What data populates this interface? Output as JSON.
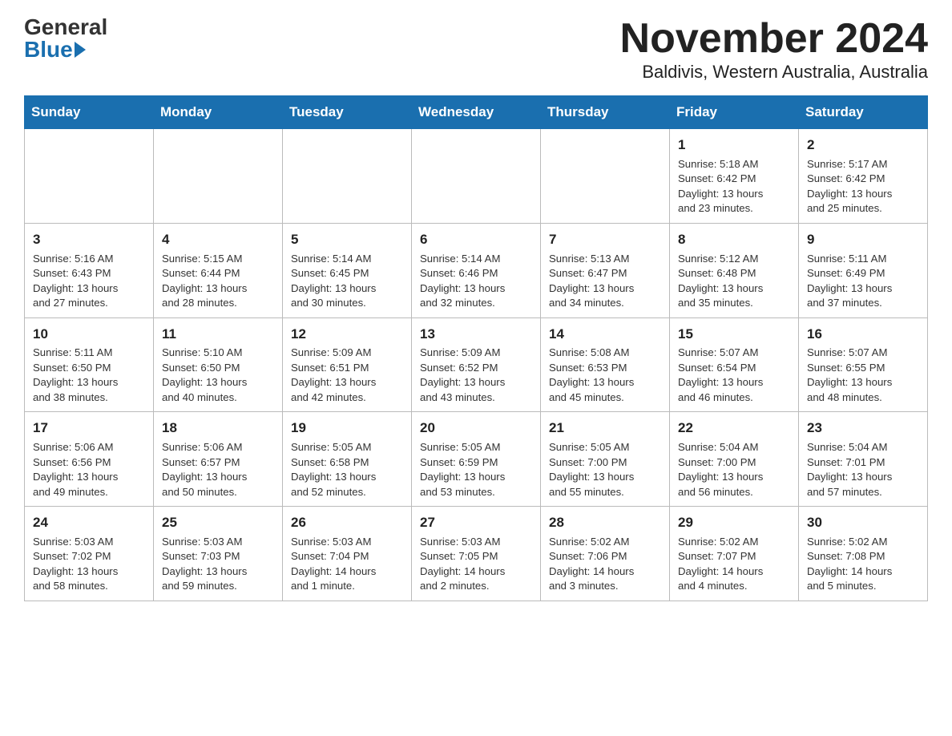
{
  "logo": {
    "general": "General",
    "blue": "Blue"
  },
  "title": "November 2024",
  "location": "Baldivis, Western Australia, Australia",
  "days_of_week": [
    "Sunday",
    "Monday",
    "Tuesday",
    "Wednesday",
    "Thursday",
    "Friday",
    "Saturday"
  ],
  "weeks": [
    [
      {
        "day": "",
        "info": ""
      },
      {
        "day": "",
        "info": ""
      },
      {
        "day": "",
        "info": ""
      },
      {
        "day": "",
        "info": ""
      },
      {
        "day": "",
        "info": ""
      },
      {
        "day": "1",
        "info": "Sunrise: 5:18 AM\nSunset: 6:42 PM\nDaylight: 13 hours\nand 23 minutes."
      },
      {
        "day": "2",
        "info": "Sunrise: 5:17 AM\nSunset: 6:42 PM\nDaylight: 13 hours\nand 25 minutes."
      }
    ],
    [
      {
        "day": "3",
        "info": "Sunrise: 5:16 AM\nSunset: 6:43 PM\nDaylight: 13 hours\nand 27 minutes."
      },
      {
        "day": "4",
        "info": "Sunrise: 5:15 AM\nSunset: 6:44 PM\nDaylight: 13 hours\nand 28 minutes."
      },
      {
        "day": "5",
        "info": "Sunrise: 5:14 AM\nSunset: 6:45 PM\nDaylight: 13 hours\nand 30 minutes."
      },
      {
        "day": "6",
        "info": "Sunrise: 5:14 AM\nSunset: 6:46 PM\nDaylight: 13 hours\nand 32 minutes."
      },
      {
        "day": "7",
        "info": "Sunrise: 5:13 AM\nSunset: 6:47 PM\nDaylight: 13 hours\nand 34 minutes."
      },
      {
        "day": "8",
        "info": "Sunrise: 5:12 AM\nSunset: 6:48 PM\nDaylight: 13 hours\nand 35 minutes."
      },
      {
        "day": "9",
        "info": "Sunrise: 5:11 AM\nSunset: 6:49 PM\nDaylight: 13 hours\nand 37 minutes."
      }
    ],
    [
      {
        "day": "10",
        "info": "Sunrise: 5:11 AM\nSunset: 6:50 PM\nDaylight: 13 hours\nand 38 minutes."
      },
      {
        "day": "11",
        "info": "Sunrise: 5:10 AM\nSunset: 6:50 PM\nDaylight: 13 hours\nand 40 minutes."
      },
      {
        "day": "12",
        "info": "Sunrise: 5:09 AM\nSunset: 6:51 PM\nDaylight: 13 hours\nand 42 minutes."
      },
      {
        "day": "13",
        "info": "Sunrise: 5:09 AM\nSunset: 6:52 PM\nDaylight: 13 hours\nand 43 minutes."
      },
      {
        "day": "14",
        "info": "Sunrise: 5:08 AM\nSunset: 6:53 PM\nDaylight: 13 hours\nand 45 minutes."
      },
      {
        "day": "15",
        "info": "Sunrise: 5:07 AM\nSunset: 6:54 PM\nDaylight: 13 hours\nand 46 minutes."
      },
      {
        "day": "16",
        "info": "Sunrise: 5:07 AM\nSunset: 6:55 PM\nDaylight: 13 hours\nand 48 minutes."
      }
    ],
    [
      {
        "day": "17",
        "info": "Sunrise: 5:06 AM\nSunset: 6:56 PM\nDaylight: 13 hours\nand 49 minutes."
      },
      {
        "day": "18",
        "info": "Sunrise: 5:06 AM\nSunset: 6:57 PM\nDaylight: 13 hours\nand 50 minutes."
      },
      {
        "day": "19",
        "info": "Sunrise: 5:05 AM\nSunset: 6:58 PM\nDaylight: 13 hours\nand 52 minutes."
      },
      {
        "day": "20",
        "info": "Sunrise: 5:05 AM\nSunset: 6:59 PM\nDaylight: 13 hours\nand 53 minutes."
      },
      {
        "day": "21",
        "info": "Sunrise: 5:05 AM\nSunset: 7:00 PM\nDaylight: 13 hours\nand 55 minutes."
      },
      {
        "day": "22",
        "info": "Sunrise: 5:04 AM\nSunset: 7:00 PM\nDaylight: 13 hours\nand 56 minutes."
      },
      {
        "day": "23",
        "info": "Sunrise: 5:04 AM\nSunset: 7:01 PM\nDaylight: 13 hours\nand 57 minutes."
      }
    ],
    [
      {
        "day": "24",
        "info": "Sunrise: 5:03 AM\nSunset: 7:02 PM\nDaylight: 13 hours\nand 58 minutes."
      },
      {
        "day": "25",
        "info": "Sunrise: 5:03 AM\nSunset: 7:03 PM\nDaylight: 13 hours\nand 59 minutes."
      },
      {
        "day": "26",
        "info": "Sunrise: 5:03 AM\nSunset: 7:04 PM\nDaylight: 14 hours\nand 1 minute."
      },
      {
        "day": "27",
        "info": "Sunrise: 5:03 AM\nSunset: 7:05 PM\nDaylight: 14 hours\nand 2 minutes."
      },
      {
        "day": "28",
        "info": "Sunrise: 5:02 AM\nSunset: 7:06 PM\nDaylight: 14 hours\nand 3 minutes."
      },
      {
        "day": "29",
        "info": "Sunrise: 5:02 AM\nSunset: 7:07 PM\nDaylight: 14 hours\nand 4 minutes."
      },
      {
        "day": "30",
        "info": "Sunrise: 5:02 AM\nSunset: 7:08 PM\nDaylight: 14 hours\nand 5 minutes."
      }
    ]
  ]
}
